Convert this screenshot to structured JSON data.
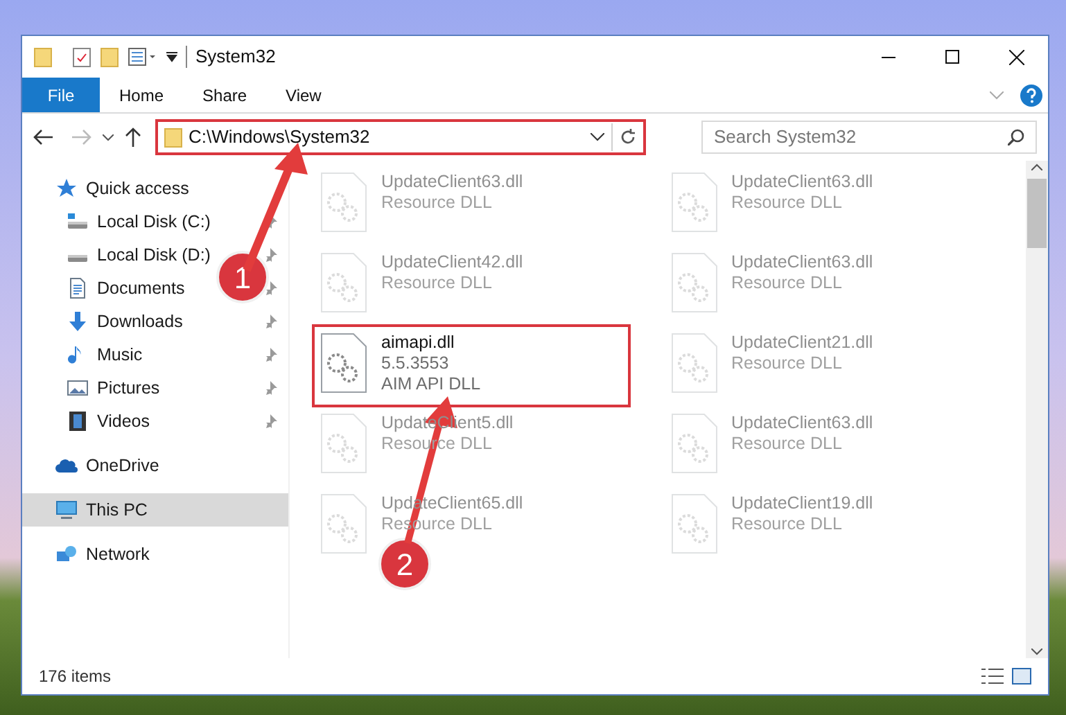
{
  "window": {
    "title": "System32"
  },
  "ribbon_tabs": [
    {
      "label": "File",
      "kind": "file"
    },
    {
      "label": "Home",
      "kind": "tab"
    },
    {
      "label": "Share",
      "kind": "tab"
    },
    {
      "label": "View",
      "kind": "tab"
    }
  ],
  "address_bar": {
    "path": "C:\\Windows\\System32",
    "highlighted": true
  },
  "search": {
    "placeholder": "Search System32"
  },
  "sidebar": [
    {
      "label": "Quick access",
      "kind": "star",
      "selected": false,
      "children": [
        {
          "label": "Local Disk (C:)",
          "kind": "system-drive",
          "selected": false,
          "pinned": true
        },
        {
          "label": "Local Disk (D:)",
          "kind": "drive",
          "selected": false,
          "pinned": true
        },
        {
          "label": "Documents",
          "kind": "document",
          "selected": false,
          "pinned": true
        },
        {
          "label": "Downloads",
          "kind": "download",
          "selected": false,
          "pinned": true
        },
        {
          "label": "Music",
          "kind": "music",
          "selected": false,
          "pinned": true
        },
        {
          "label": "Pictures",
          "kind": "picture",
          "selected": false,
          "pinned": true
        },
        {
          "label": "Videos",
          "kind": "video",
          "selected": false,
          "pinned": true
        }
      ]
    },
    {
      "label": "OneDrive",
      "kind": "cloud",
      "selected": false
    },
    {
      "label": "This PC",
      "kind": "computer",
      "selected": true
    },
    {
      "label": "Network",
      "kind": "network",
      "selected": false
    }
  ],
  "files": [
    {
      "name": "UpdateClient63.dll",
      "lines": [
        "Resource DLL"
      ],
      "blurred": true,
      "highlighted": false
    },
    {
      "name": "UpdateClient63.dll",
      "lines": [
        "Resource DLL"
      ],
      "blurred": true,
      "highlighted": false
    },
    {
      "name": "UpdateClient42.dll",
      "lines": [
        "Resource DLL"
      ],
      "blurred": true,
      "highlighted": false
    },
    {
      "name": "UpdateClient63.dll",
      "lines": [
        "Resource DLL"
      ],
      "blurred": true,
      "highlighted": false
    },
    {
      "name": "aimapi.dll",
      "lines": [
        "5.5.3553",
        "AIM API DLL"
      ],
      "blurred": false,
      "highlighted": true
    },
    {
      "name": "UpdateClient21.dll",
      "lines": [
        "Resource DLL"
      ],
      "blurred": true,
      "highlighted": false
    },
    {
      "name": "UpdateClient5.dll",
      "lines": [
        "Resource DLL"
      ],
      "blurred": true,
      "highlighted": false
    },
    {
      "name": "UpdateClient63.dll",
      "lines": [
        "Resource DLL"
      ],
      "blurred": true,
      "highlighted": false
    },
    {
      "name": "UpdateClient65.dll",
      "lines": [
        "Resource DLL"
      ],
      "blurred": true,
      "highlighted": false
    },
    {
      "name": "UpdateClient19.dll",
      "lines": [
        "Resource DLL"
      ],
      "blurred": true,
      "highlighted": false
    }
  ],
  "status_bar": {
    "item_count": "176 items"
  },
  "callouts": [
    {
      "number": "1"
    },
    {
      "number": "2"
    }
  ]
}
